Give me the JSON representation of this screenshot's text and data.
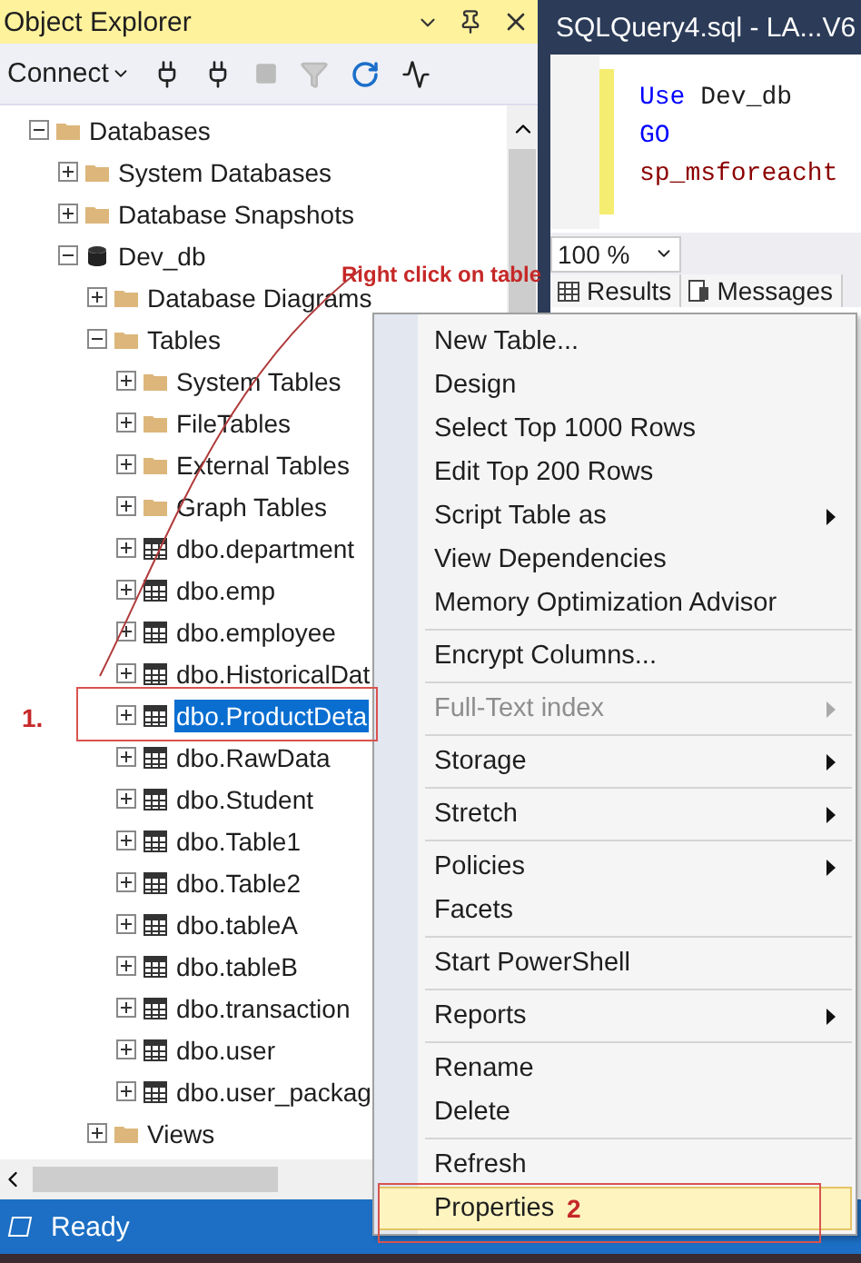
{
  "object_explorer": {
    "title": "Object Explorer",
    "toolbar": {
      "connect": "Connect"
    },
    "tree": [
      {
        "label": "Databases",
        "kind": "folder",
        "expanded": true,
        "selected": false,
        "children": [
          {
            "label": "System Databases",
            "kind": "folder",
            "expanded": false,
            "selected": false
          },
          {
            "label": "Database Snapshots",
            "kind": "folder",
            "expanded": false,
            "selected": false
          },
          {
            "label": "Dev_db",
            "kind": "database",
            "expanded": true,
            "selected": false,
            "children": [
              {
                "label": "Database Diagrams",
                "kind": "folder",
                "expanded": false,
                "selected": false
              },
              {
                "label": "Tables",
                "kind": "folder",
                "expanded": true,
                "selected": false,
                "children": [
                  {
                    "label": "System Tables",
                    "kind": "folder",
                    "expanded": false,
                    "selected": false
                  },
                  {
                    "label": "FileTables",
                    "kind": "folder",
                    "expanded": false,
                    "selected": false
                  },
                  {
                    "label": "External Tables",
                    "kind": "folder",
                    "expanded": false,
                    "selected": false
                  },
                  {
                    "label": "Graph Tables",
                    "kind": "folder",
                    "expanded": false,
                    "selected": false
                  },
                  {
                    "label": "dbo.department",
                    "kind": "table",
                    "expanded": false,
                    "selected": false
                  },
                  {
                    "label": "dbo.emp",
                    "kind": "table",
                    "expanded": false,
                    "selected": false
                  },
                  {
                    "label": "dbo.employee",
                    "kind": "table",
                    "expanded": false,
                    "selected": false
                  },
                  {
                    "label": "dbo.HistoricalDat",
                    "kind": "table",
                    "expanded": false,
                    "selected": false
                  },
                  {
                    "label": "dbo.ProductDeta",
                    "kind": "table",
                    "expanded": false,
                    "selected": true
                  },
                  {
                    "label": "dbo.RawData",
                    "kind": "table",
                    "expanded": false,
                    "selected": false
                  },
                  {
                    "label": "dbo.Student",
                    "kind": "table",
                    "expanded": false,
                    "selected": false
                  },
                  {
                    "label": "dbo.Table1",
                    "kind": "table",
                    "expanded": false,
                    "selected": false
                  },
                  {
                    "label": "dbo.Table2",
                    "kind": "table",
                    "expanded": false,
                    "selected": false
                  },
                  {
                    "label": "dbo.tableA",
                    "kind": "table",
                    "expanded": false,
                    "selected": false
                  },
                  {
                    "label": "dbo.tableB",
                    "kind": "table",
                    "expanded": false,
                    "selected": false
                  },
                  {
                    "label": "dbo.transaction",
                    "kind": "table",
                    "expanded": false,
                    "selected": false
                  },
                  {
                    "label": "dbo.user",
                    "kind": "table",
                    "expanded": false,
                    "selected": false
                  },
                  {
                    "label": "dbo.user_packag",
                    "kind": "table",
                    "expanded": false,
                    "selected": false
                  }
                ]
              },
              {
                "label": "Views",
                "kind": "folder",
                "expanded": false,
                "selected": false
              }
            ]
          }
        ]
      }
    ]
  },
  "editor": {
    "tab_title": "SQLQuery4.sql - LA...V6",
    "code": [
      [
        {
          "kind": "keyword",
          "text": "Use"
        },
        {
          "kind": "plain",
          "text": " Dev_db"
        }
      ],
      [
        {
          "kind": "keyword",
          "text": "GO"
        }
      ],
      [
        {
          "kind": "procedure",
          "text": "sp_msforeacht"
        }
      ]
    ],
    "zoom": "100 %",
    "result_tabs": [
      {
        "label": "Results",
        "kind": "grid"
      },
      {
        "label": "Messages",
        "kind": "messages"
      }
    ]
  },
  "context_menu": {
    "items": [
      {
        "kind": "item",
        "label": "New Table...",
        "submenu": false,
        "disabled": false,
        "selected": false
      },
      {
        "kind": "item",
        "label": "Design",
        "submenu": false,
        "disabled": false,
        "selected": false
      },
      {
        "kind": "item",
        "label": "Select Top 1000 Rows",
        "submenu": false,
        "disabled": false,
        "selected": false
      },
      {
        "kind": "item",
        "label": "Edit Top 200 Rows",
        "submenu": false,
        "disabled": false,
        "selected": false
      },
      {
        "kind": "item",
        "label": "Script Table as",
        "submenu": true,
        "disabled": false,
        "selected": false
      },
      {
        "kind": "item",
        "label": "View Dependencies",
        "submenu": false,
        "disabled": false,
        "selected": false
      },
      {
        "kind": "item",
        "label": "Memory Optimization Advisor",
        "submenu": false,
        "disabled": false,
        "selected": false
      },
      {
        "kind": "separator"
      },
      {
        "kind": "item",
        "label": "Encrypt Columns...",
        "submenu": false,
        "disabled": false,
        "selected": false
      },
      {
        "kind": "separator"
      },
      {
        "kind": "item",
        "label": "Full-Text index",
        "submenu": true,
        "disabled": true,
        "selected": false
      },
      {
        "kind": "separator"
      },
      {
        "kind": "item",
        "label": "Storage",
        "submenu": true,
        "disabled": false,
        "selected": false
      },
      {
        "kind": "separator"
      },
      {
        "kind": "item",
        "label": "Stretch",
        "submenu": true,
        "disabled": false,
        "selected": false
      },
      {
        "kind": "separator"
      },
      {
        "kind": "item",
        "label": "Policies",
        "submenu": true,
        "disabled": false,
        "selected": false
      },
      {
        "kind": "item",
        "label": "Facets",
        "submenu": false,
        "disabled": false,
        "selected": false
      },
      {
        "kind": "separator"
      },
      {
        "kind": "item",
        "label": "Start PowerShell",
        "submenu": false,
        "disabled": false,
        "selected": false
      },
      {
        "kind": "separator"
      },
      {
        "kind": "item",
        "label": "Reports",
        "submenu": true,
        "disabled": false,
        "selected": false
      },
      {
        "kind": "separator"
      },
      {
        "kind": "item",
        "label": "Rename",
        "submenu": false,
        "disabled": false,
        "selected": false
      },
      {
        "kind": "item",
        "label": "Delete",
        "submenu": false,
        "disabled": false,
        "selected": false
      },
      {
        "kind": "separator"
      },
      {
        "kind": "item",
        "label": "Refresh",
        "submenu": false,
        "disabled": false,
        "selected": false
      },
      {
        "kind": "item",
        "label": "Properties",
        "submenu": false,
        "disabled": false,
        "selected": true
      }
    ]
  },
  "status_bar": {
    "text": "Ready"
  },
  "annotations": [
    {
      "kind": "callout",
      "text": "Right click on table"
    },
    {
      "kind": "step",
      "text": "1."
    },
    {
      "kind": "step",
      "text": "2"
    }
  ]
}
